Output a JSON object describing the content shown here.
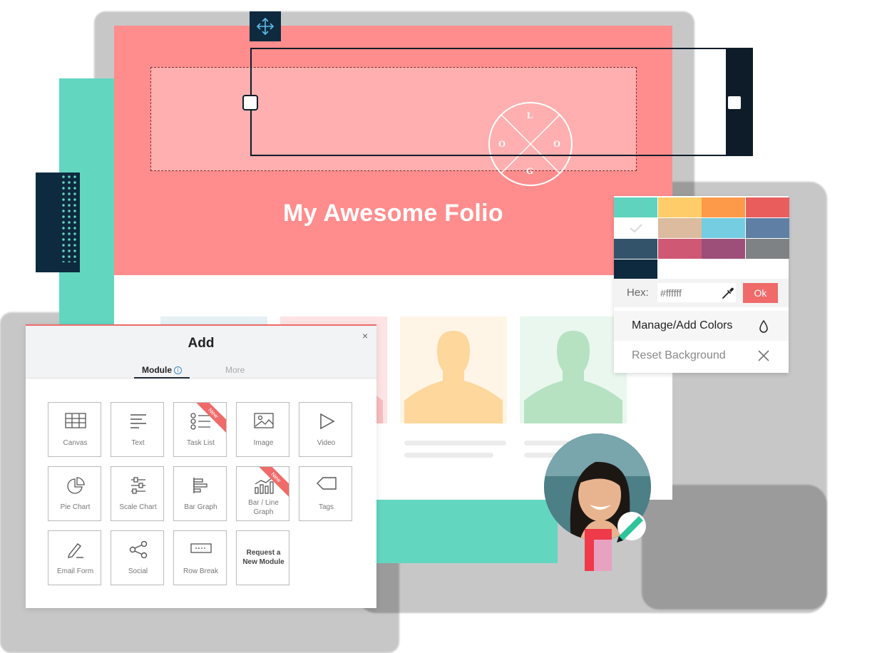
{
  "hero": {
    "title": "My Awesome Folio",
    "logo_letters": {
      "top": "L",
      "left": "O",
      "right": "O",
      "bottom": "G"
    }
  },
  "profile_cards": [
    {
      "bg": "#e6f1f6",
      "figure": "#cfe2ec"
    },
    {
      "bg": "#fde3e3",
      "figure": "#f7bcbc"
    },
    {
      "bg": "#fff5e6",
      "figure": "#fdd79c"
    },
    {
      "bg": "#e9f7ee",
      "figure": "#b6e2c2"
    }
  ],
  "color_picker": {
    "swatches": [
      "#5fd3bd",
      "#fecd6a",
      "#fc9a4a",
      "#ea5d5d",
      "#ffffff",
      "#dcbb9f",
      "#74cde0",
      "#5f80a4",
      "#33536b",
      "#cf5974",
      "#9d4f79",
      "#7e8285",
      "#0e2a3f"
    ],
    "selected_index": 4,
    "hex_label": "Hex:",
    "hex_value": "#ffffff",
    "ok_label": "Ok",
    "manage_label": "Manage/Add Colors",
    "reset_label": "Reset Background"
  },
  "add_panel": {
    "title": "Add",
    "close": "×",
    "tabs": {
      "module": "Module",
      "more": "More",
      "info": "i"
    },
    "new_badge": "New",
    "modules": [
      {
        "label": "Canvas",
        "icon": "canvas-icon",
        "new": false
      },
      {
        "label": "Text",
        "icon": "text-icon",
        "new": false
      },
      {
        "label": "Task List",
        "icon": "task-list-icon",
        "new": true
      },
      {
        "label": "Image",
        "icon": "image-icon",
        "new": false
      },
      {
        "label": "Video",
        "icon": "video-icon",
        "new": false
      },
      {
        "label": "Pie Chart",
        "icon": "pie-chart-icon",
        "new": false
      },
      {
        "label": "Scale Chart",
        "icon": "scale-chart-icon",
        "new": false
      },
      {
        "label": "Bar Graph",
        "icon": "bar-graph-icon",
        "new": false
      },
      {
        "label": "Bar / Line Graph",
        "icon": "bar-line-graph-icon",
        "new": true
      },
      {
        "label": "Tags",
        "icon": "tag-icon",
        "new": false
      },
      {
        "label": "Email Form",
        "icon": "pencil-icon",
        "new": false
      },
      {
        "label": "Social",
        "icon": "share-icon",
        "new": false
      },
      {
        "label": "Row Break",
        "icon": "row-break-icon",
        "new": false
      }
    ],
    "request": {
      "line1": "Request a",
      "line2": "New Module"
    }
  },
  "colors": {
    "hero": "#ff8d8d",
    "accent": "#f06a6a",
    "teal": "#63d6c0",
    "navy": "#0e2a3f"
  }
}
